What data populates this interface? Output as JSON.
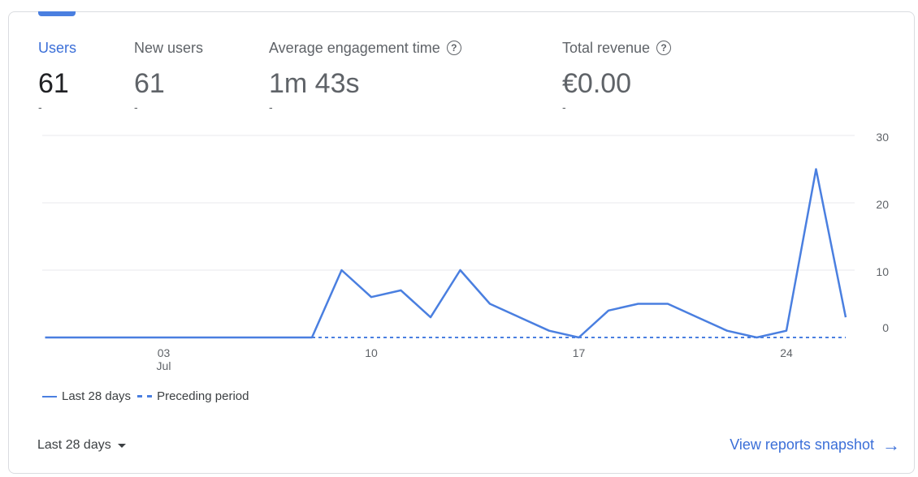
{
  "metrics": [
    {
      "label": "Users",
      "value": "61",
      "delta": "-",
      "help": false,
      "active": true
    },
    {
      "label": "New users",
      "value": "61",
      "delta": "-",
      "help": false,
      "active": false
    },
    {
      "label": "Average engagement time",
      "value": "1m 43s",
      "delta": "-",
      "help": true,
      "active": false
    },
    {
      "label": "Total revenue",
      "value": "€0.00",
      "delta": "-",
      "help": true,
      "active": false
    }
  ],
  "help_icon_glyph": "?",
  "chart_data": {
    "type": "line",
    "title": "",
    "xlabel": "",
    "ylabel": "",
    "ylim": [
      0,
      30
    ],
    "yticks": [
      "0",
      "10",
      "20",
      "30"
    ],
    "x_tick_labels": [
      {
        "day": 3,
        "label": "03",
        "sublabel": "Jul"
      },
      {
        "day": 10,
        "label": "10",
        "sublabel": ""
      },
      {
        "day": 17,
        "label": "17",
        "sublabel": ""
      },
      {
        "day": 24,
        "label": "24",
        "sublabel": ""
      }
    ],
    "x_days": [
      -1,
      0,
      1,
      2,
      3,
      4,
      5,
      6,
      7,
      8,
      9,
      10,
      11,
      12,
      13,
      14,
      15,
      16,
      17,
      18,
      19,
      20,
      21,
      22,
      23,
      24,
      25,
      26
    ],
    "grid": true,
    "legend_position": "bottom-left",
    "series": [
      {
        "name": "Last 28 days",
        "style": "solid",
        "color": "#4a7fe0",
        "values": [
          0,
          0,
          0,
          0,
          0,
          0,
          0,
          0,
          0,
          0,
          10,
          6,
          7,
          3,
          10,
          5,
          3,
          1,
          0,
          4,
          5,
          5,
          3,
          1,
          0,
          1,
          25,
          3
        ]
      },
      {
        "name": "Preceding period",
        "style": "dashed",
        "color": "#4a7fe0",
        "values": [
          null,
          null,
          null,
          null,
          null,
          null,
          null,
          null,
          null,
          0,
          0,
          0,
          0,
          0,
          0,
          0,
          0,
          0,
          0,
          0,
          0,
          0,
          0,
          0,
          0,
          0,
          0,
          0
        ]
      }
    ]
  },
  "footer": {
    "range_label": "Last 28 days",
    "view_link": "View reports snapshot",
    "arrow_glyph": "→"
  }
}
